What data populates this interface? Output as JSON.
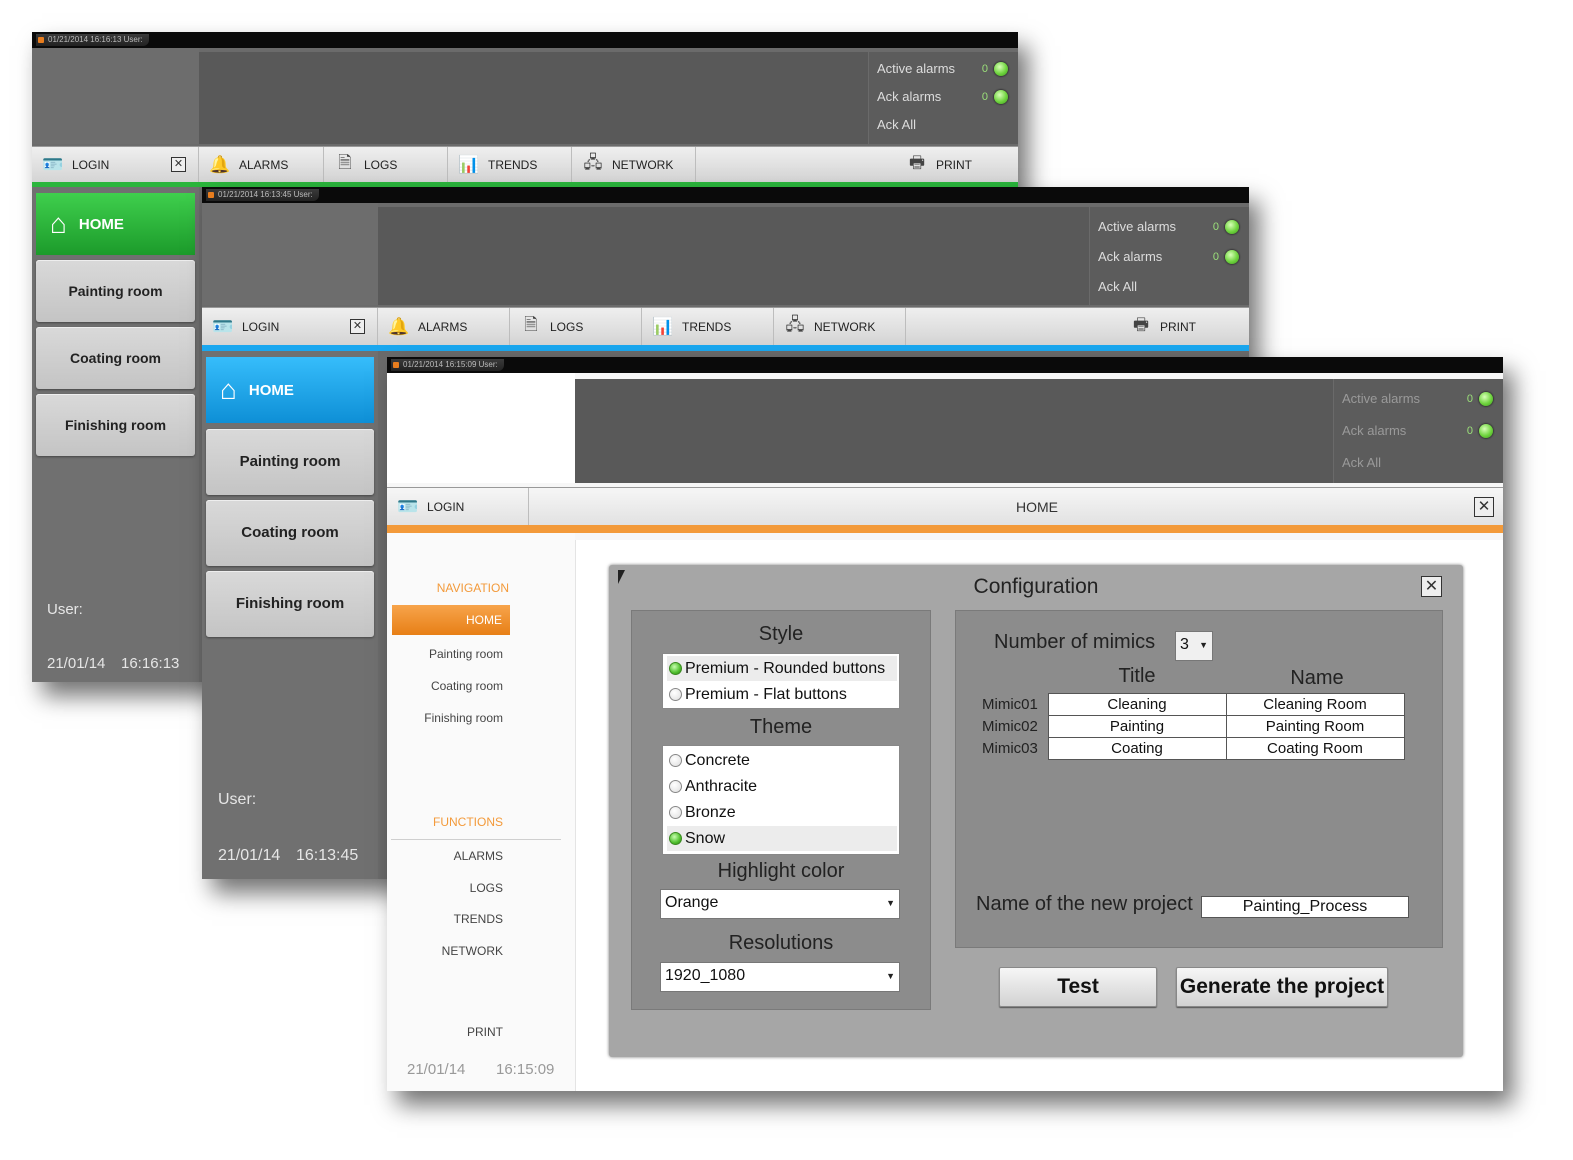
{
  "windows": [
    {
      "id": "green",
      "accent": "#2bb53c",
      "title_stamp": "01/21/2014 16:16:13 User:",
      "alarms": {
        "active_label": "Active alarms",
        "active_count": "0",
        "ack_label": "Ack alarms",
        "ack_count": "0",
        "ack_all": "Ack All"
      },
      "toolbar": {
        "login": "LOGIN",
        "alarms": "ALARMS",
        "logs": "LOGS",
        "trends": "TRENDS",
        "network": "NETWORK",
        "print": "PRINT"
      },
      "sidebar": {
        "home": "HOME",
        "items": [
          "Painting room",
          "Coating room",
          "Finishing room"
        ],
        "user": "User:",
        "date": "21/01/14",
        "time": "16:16:13"
      }
    },
    {
      "id": "blue",
      "accent": "#1aa7ef",
      "title_stamp": "01/21/2014 16:13:45 User:",
      "alarms": {
        "active_label": "Active alarms",
        "active_count": "0",
        "ack_label": "Ack alarms",
        "ack_count": "0",
        "ack_all": "Ack All"
      },
      "toolbar": {
        "login": "LOGIN",
        "alarms": "ALARMS",
        "logs": "LOGS",
        "trends": "TRENDS",
        "network": "NETWORK",
        "print": "PRINT"
      },
      "sidebar": {
        "home": "HOME",
        "items": [
          "Painting room",
          "Coating room",
          "Finishing room"
        ],
        "user": "User:",
        "date": "21/01/14",
        "time": "16:13:45"
      }
    },
    {
      "id": "orange",
      "accent": "#f39a3a",
      "title_stamp": "01/21/2014 16:15:09 User:",
      "alarms": {
        "active_label": "Active alarms",
        "active_count": "0",
        "ack_label": "Ack alarms",
        "ack_count": "0",
        "ack_all": "Ack All"
      },
      "toolbar": {
        "login": "LOGIN",
        "page_title": "HOME"
      },
      "nav": {
        "navigation_header": "NAVIGATION",
        "home": "HOME",
        "items": [
          "Painting room",
          "Coating room",
          "Finishing room"
        ],
        "functions_header": "FUNCTIONS",
        "functions": [
          "ALARMS",
          "LOGS",
          "TRENDS",
          "NETWORK"
        ],
        "print": "PRINT",
        "date": "21/01/14",
        "time": "16:15:09"
      },
      "config": {
        "title": "Configuration",
        "style_label": "Style",
        "style_options": [
          {
            "label": "Premium - Rounded buttons",
            "selected": true
          },
          {
            "label": "Premium - Flat buttons",
            "selected": false
          }
        ],
        "theme_label": "Theme",
        "theme_options": [
          {
            "label": "Concrete",
            "selected": false
          },
          {
            "label": "Anthracite",
            "selected": false
          },
          {
            "label": "Bronze",
            "selected": false
          },
          {
            "label": "Snow",
            "selected": true
          }
        ],
        "highlight_label": "Highlight color",
        "highlight_value": "Orange",
        "resolutions_label": "Resolutions",
        "resolution_value": "1920_1080",
        "mimics_label": "Number of mimics",
        "mimics_value": "3",
        "col_title": "Title",
        "col_name": "Name",
        "mimics": [
          {
            "id": "Mimic01",
            "title": "Cleaning",
            "name": "Cleaning Room"
          },
          {
            "id": "Mimic02",
            "title": "Painting",
            "name": "Painting Room"
          },
          {
            "id": "Mimic03",
            "title": "Coating",
            "name": "Coating Room"
          }
        ],
        "project_label": "Name of the new project",
        "project_value": "Painting_Process",
        "test_button": "Test",
        "generate_button": "Generate the project"
      }
    }
  ],
  "icons": {
    "login": "id-card-icon",
    "close": "close-icon",
    "alarms": "bell-icon",
    "logs": "document-clock-icon",
    "trends": "chart-icon",
    "network": "network-icon",
    "print": "printer-icon",
    "home": "house-icon",
    "cursor": "mouse-pointer-icon"
  }
}
